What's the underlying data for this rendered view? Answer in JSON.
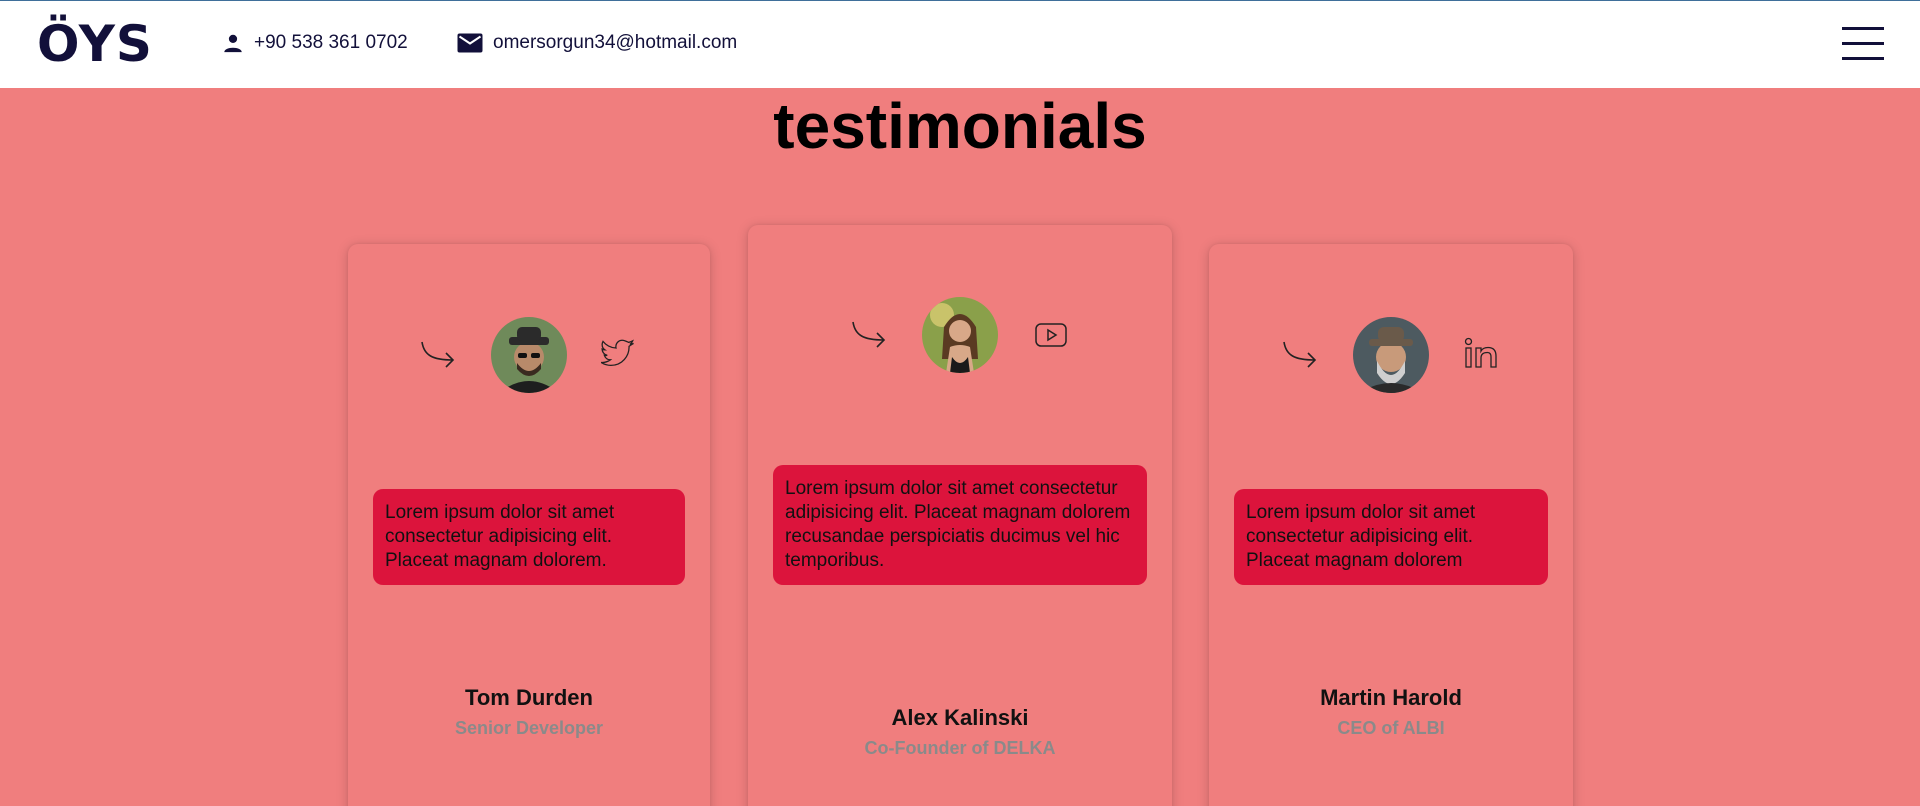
{
  "header": {
    "logo": "ÖYS",
    "phone": "+90 538 361 0702",
    "email": "omersorgun34@hotmail.com"
  },
  "section": {
    "title": "testimonials"
  },
  "testimonials": [
    {
      "name": "Tom Durden",
      "role": "Senior Developer",
      "text": "Lorem ipsum dolor sit amet consectetur adipisicing elit. Placeat magnam dolorem.",
      "social_icon": "twitter-icon"
    },
    {
      "name": "Alex Kalinski",
      "role": "Co-Founder of DELKA",
      "text": "Lorem ipsum dolor sit amet consectetur adipisicing elit. Placeat magnam dolorem recusandae perspiciatis ducimus vel hic temporibus.",
      "social_icon": "youtube-icon"
    },
    {
      "name": "Martin Harold",
      "role": "CEO of ALBI",
      "text": "Lorem ipsum dolor sit amet consectetur adipisicing elit. Placeat magnam dolorem",
      "social_icon": "linkedin-icon"
    }
  ],
  "colors": {
    "background": "#f07e7e",
    "quote_bg": "#dc143c",
    "header_text": "#12103a",
    "role_text": "#8a8a8a"
  }
}
